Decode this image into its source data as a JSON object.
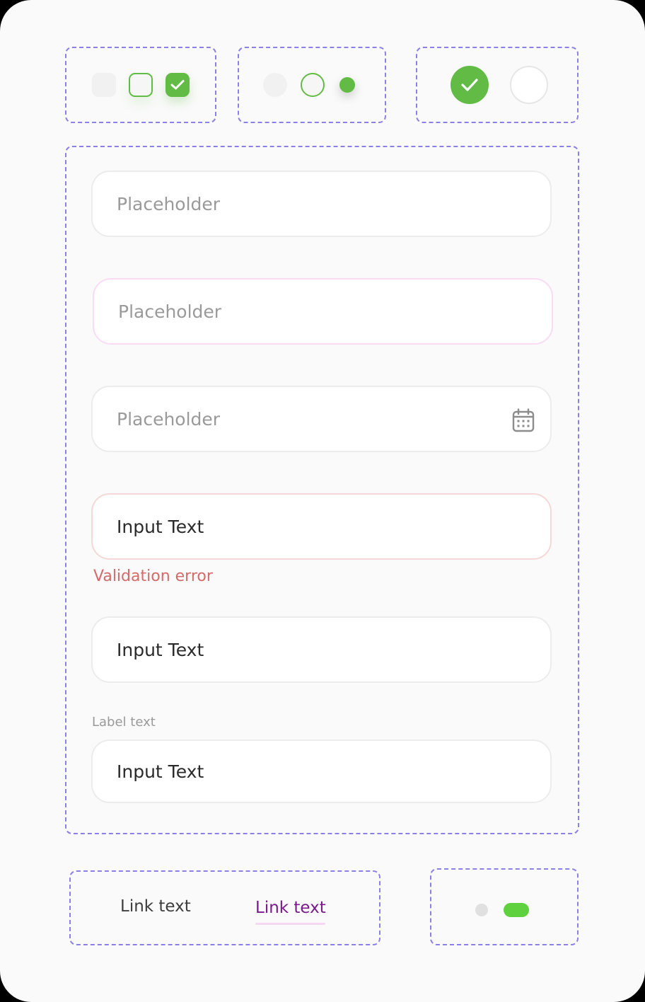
{
  "colors": {
    "accent_green": "#62bb45",
    "dashed_border": "#8b7fe8",
    "error_red": "#d46a6a",
    "link_purple": "#7a1a8a",
    "toggle_green": "#5fd03e"
  },
  "checkboxes": [
    {
      "state": "unchecked-disabled"
    },
    {
      "state": "unchecked"
    },
    {
      "state": "checked",
      "icon": "check-icon"
    }
  ],
  "radios": [
    {
      "state": "unselected-disabled"
    },
    {
      "state": "unselected"
    },
    {
      "state": "selected"
    }
  ],
  "circle_checks": [
    {
      "state": "checked",
      "icon": "check-icon"
    },
    {
      "state": "unchecked"
    }
  ],
  "form": {
    "field1": {
      "placeholder": "Placeholder"
    },
    "field2": {
      "placeholder": "Placeholder"
    },
    "field3": {
      "placeholder": "Placeholder",
      "icon": "calendar-icon"
    },
    "field4": {
      "value": "Input Text",
      "error": "Validation error"
    },
    "field5": {
      "value": "Input Text"
    },
    "field6": {
      "label": "Label text",
      "value": "Input Text"
    }
  },
  "links": {
    "link1": "Link text",
    "link2": "Link text"
  },
  "toggle": {
    "active_index": 1
  }
}
